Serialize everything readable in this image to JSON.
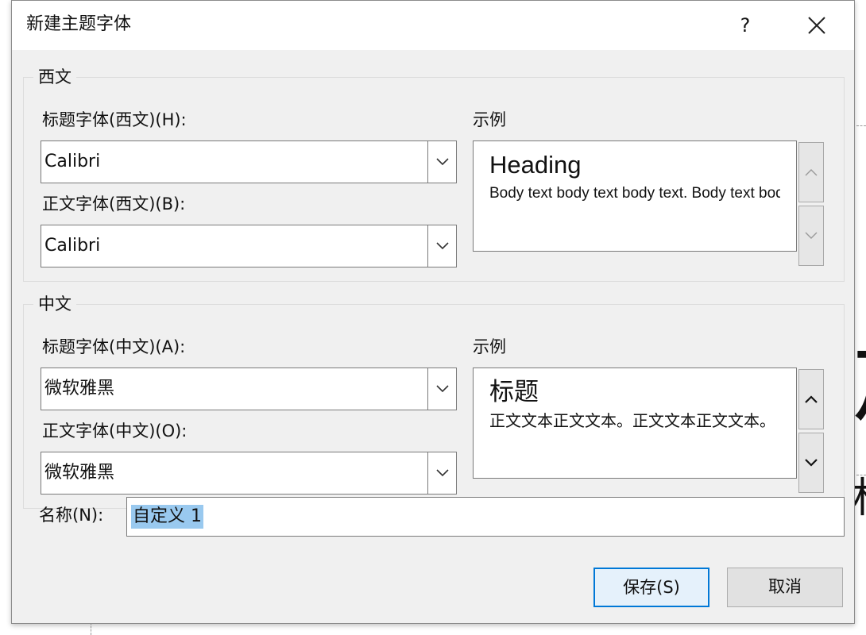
{
  "dialog": {
    "title": "新建主题字体",
    "help_label": "?"
  },
  "western": {
    "legend": "西文",
    "heading_label": "标题字体(西文)(H):",
    "heading_font": "Calibri",
    "body_label": "正文字体(西文)(B):",
    "body_font": "Calibri",
    "sample_label": "示例",
    "sample_heading": "Heading",
    "sample_body": "Body text body text body text. Body text body text."
  },
  "chinese": {
    "legend": "中文",
    "heading_label": "标题字体(中文)(A):",
    "heading_font": "微软雅黑",
    "body_label": "正文字体(中文)(O):",
    "body_font": "微软雅黑",
    "sample_label": "示例",
    "sample_heading": "标题",
    "sample_body": "正文文本正文文本。正文文本正文文本。"
  },
  "name": {
    "label": "名称(N):",
    "value": "自定义 1"
  },
  "buttons": {
    "save": "保存(S)",
    "cancel": "取消"
  },
  "background": {
    "glyph_large": "加",
    "glyph_small": "标"
  },
  "colors": {
    "dialog_bg": "#f0f0f0",
    "accent": "#0078d7",
    "selection": "#99c9ef"
  }
}
